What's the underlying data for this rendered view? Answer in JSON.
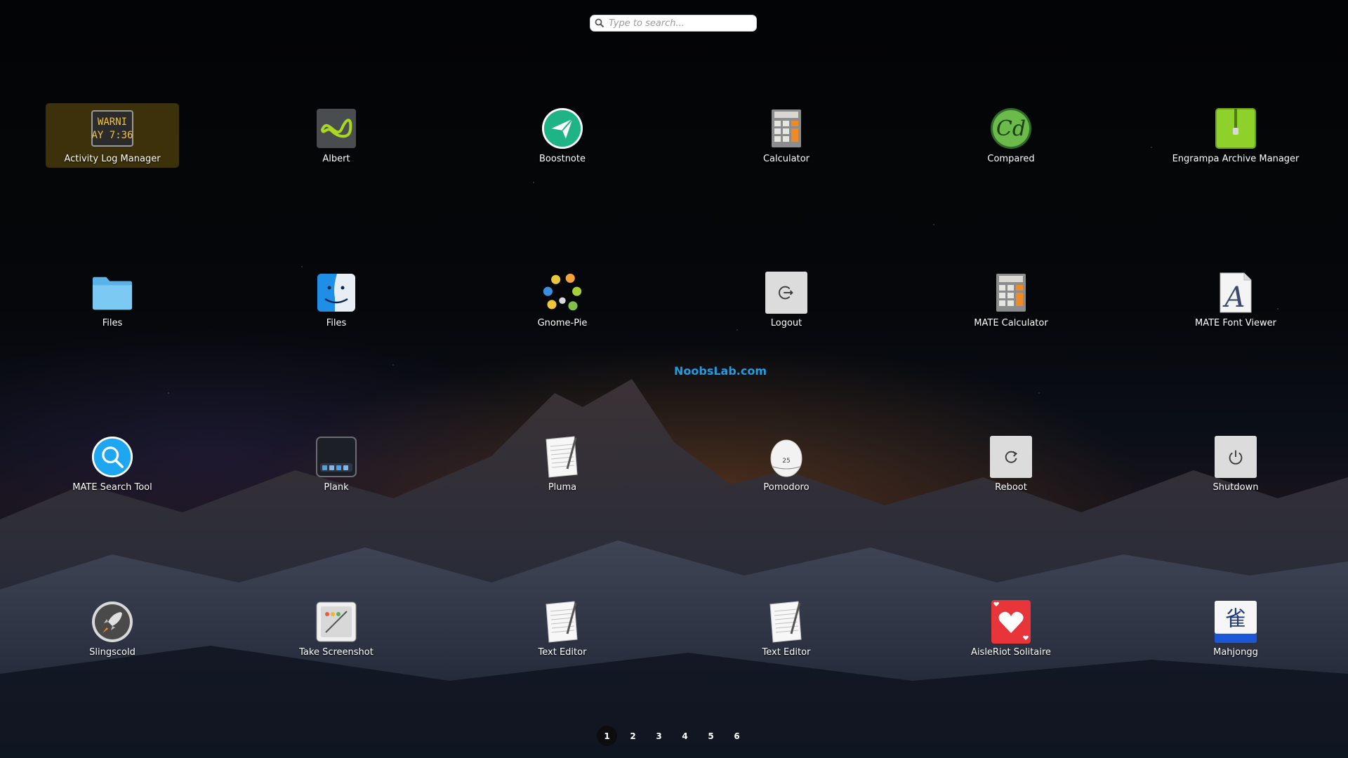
{
  "search": {
    "placeholder": "Type to search..."
  },
  "watermark": "NoobsLab.com",
  "apps": [
    {
      "label": "Activity Log Manager",
      "icon": "activity-log-icon",
      "icon_text": [
        "WARNI",
        "AY 7:36"
      ],
      "selected": true
    },
    {
      "label": "Albert",
      "icon": "albert-icon"
    },
    {
      "label": "Boostnote",
      "icon": "boostnote-icon"
    },
    {
      "label": "Calculator",
      "icon": "calculator-icon"
    },
    {
      "label": "Compared",
      "icon": "compared-icon",
      "icon_text": [
        "Cd"
      ]
    },
    {
      "label": "Engrampa Archive Manager",
      "icon": "archive-icon"
    },
    {
      "label": "Files",
      "icon": "folder-icon"
    },
    {
      "label": "Files",
      "icon": "finder-icon"
    },
    {
      "label": "Gnome-Pie",
      "icon": "gnome-pie-icon"
    },
    {
      "label": "Logout",
      "icon": "logout-icon"
    },
    {
      "label": "MATE Calculator",
      "icon": "calculator-icon"
    },
    {
      "label": "MATE Font Viewer",
      "icon": "font-viewer-icon",
      "icon_text": [
        "A"
      ]
    },
    {
      "label": "MATE Search Tool",
      "icon": "search-tool-icon"
    },
    {
      "label": "Plank",
      "icon": "plank-icon"
    },
    {
      "label": "Pluma",
      "icon": "text-editor-icon"
    },
    {
      "label": "Pomodoro",
      "icon": "pomodoro-icon",
      "icon_text": [
        "25"
      ]
    },
    {
      "label": "Reboot",
      "icon": "reboot-icon"
    },
    {
      "label": "Shutdown",
      "icon": "shutdown-icon"
    },
    {
      "label": "Slingscold",
      "icon": "rocket-icon"
    },
    {
      "label": "Take Screenshot",
      "icon": "screenshot-icon"
    },
    {
      "label": "Text Editor",
      "icon": "text-editor-icon"
    },
    {
      "label": "Text Editor",
      "icon": "text-editor-icon"
    },
    {
      "label": "AisleRiot Solitaire",
      "icon": "solitaire-icon"
    },
    {
      "label": "Mahjongg",
      "icon": "mahjongg-icon",
      "icon_text": [
        "雀"
      ]
    }
  ],
  "pages": [
    "1",
    "2",
    "3",
    "4",
    "5",
    "6"
  ],
  "active_page": "1",
  "colors": {
    "selection": "#6e550f",
    "watermark": "#1e9ce6",
    "boostnote": "#1fb486",
    "albert": "#9fd32a",
    "solitaire": "#e8353a",
    "search_tool": "#1ea7f0"
  }
}
